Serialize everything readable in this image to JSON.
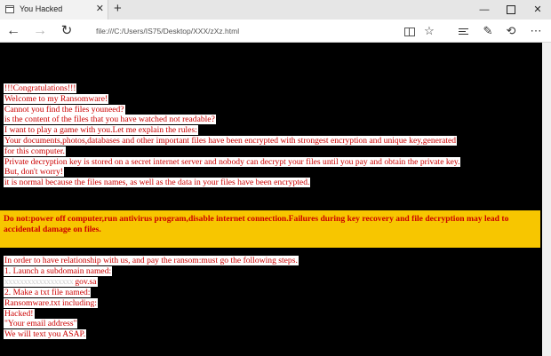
{
  "browser": {
    "tab_title": "You Hacked",
    "tab_close": "✕",
    "new_tab": "+",
    "address": "file:///C:/Users/IS75/Desktop/XXX/zXz.html",
    "window": {
      "minimize": "—",
      "close": "✕"
    },
    "nav": {
      "back": "←",
      "forward": "→",
      "refresh": "↻"
    },
    "tools": {
      "favorite": "☆",
      "notes": "✎",
      "share": "⟲",
      "more": "⋯"
    }
  },
  "message": {
    "lines": [
      "!!!Congratulations!!!",
      "Welcome to my Ransomware!",
      "Cannot you find the files youneed?",
      "is the content of the files that you have watched not readable?",
      "I want to play a game with you.Let me explain the rules:",
      "Your documents,photos,databases and other important files have been encrypted with strongest encryption and unique key,generated",
      "for this computer.",
      "Private decryption key is stored on a secret internet server and nobody can decrypt your files until you pay and obtain the private key.",
      "But, don't worry!",
      "it is normal because the files names, as well as the data in your files have been encrypted."
    ],
    "warning": "Do not:power off computer,run antivirus program,disable internet connection.Failures during key recovery and file decryption may lead to accidental damage on files.",
    "steps": {
      "intro": "In order to have relationship with us, and pay the ransom:must go the following steps.",
      "step1": "1. Launch a subdomain named:",
      "subdomain_blurred": "xxxxxxxxxxxxxxxxxx",
      "subdomain_suffix": "gov.sa",
      "step2": "2. Make a txt file named:",
      "filename": "Ransomware.txt including:",
      "content1": "Hacked!",
      "content2": "\"Your email address\"",
      "closing": "We will text you ASAP."
    }
  },
  "colors": {
    "text_red": "#cc0000",
    "background": "#000000",
    "warning_band": "#f7c600",
    "highlight": "#ffffff"
  }
}
